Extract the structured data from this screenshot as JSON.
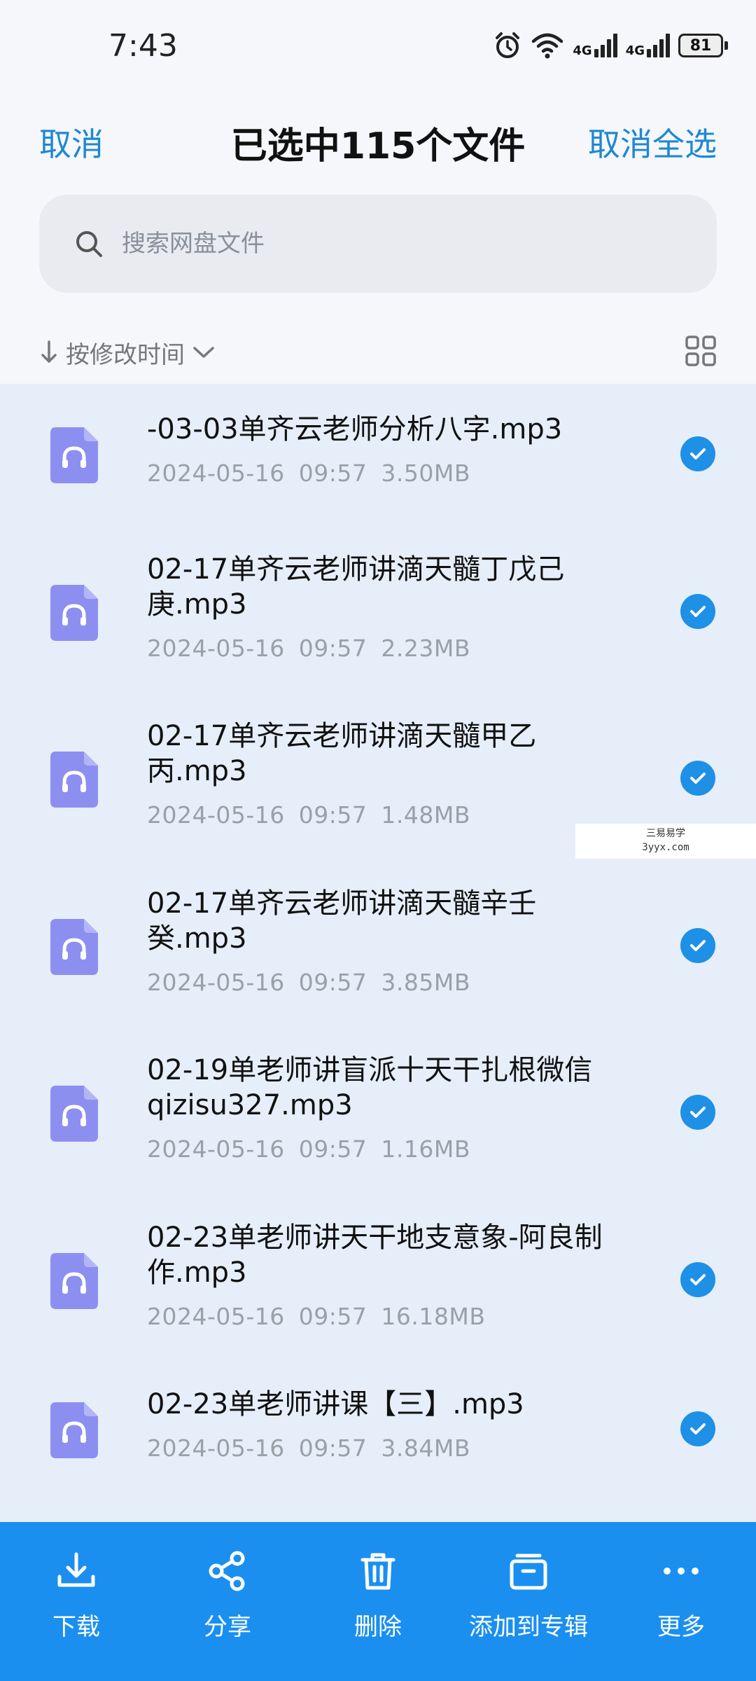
{
  "status_bar": {
    "time": "7:43",
    "network_1": "4G",
    "network_2": "4G",
    "battery": "81"
  },
  "header": {
    "cancel_label": "取消",
    "title": "已选中115个文件",
    "deselect_all_label": "取消全选"
  },
  "search": {
    "placeholder": "搜索网盘文件"
  },
  "sort": {
    "label": "按修改时间"
  },
  "files": [
    {
      "name_line1": "-03-03单齐云老师分析八字.mp3",
      "name_line2": "",
      "date": "2024-05-16",
      "time": "09:57",
      "size": "3.50MB",
      "selected": true
    },
    {
      "name_line1": "02-17单齐云老师讲滴天髓丁戊己",
      "name_line2": "庚.mp3",
      "date": "2024-05-16",
      "time": "09:57",
      "size": "2.23MB",
      "selected": true
    },
    {
      "name_line1": "02-17单齐云老师讲滴天髓甲乙",
      "name_line2": "丙.mp3",
      "date": "2024-05-16",
      "time": "09:57",
      "size": "1.48MB",
      "selected": true
    },
    {
      "name_line1": "02-17单齐云老师讲滴天髓辛壬",
      "name_line2": "癸.mp3",
      "date": "2024-05-16",
      "time": "09:57",
      "size": "3.85MB",
      "selected": true
    },
    {
      "name_line1": "02-19单老师讲盲派十天干扎根微信",
      "name_line2": "qizisu327.mp3",
      "date": "2024-05-16",
      "time": "09:57",
      "size": "1.16MB",
      "selected": true
    },
    {
      "name_line1": "02-23单老师讲天干地支意象-阿良制",
      "name_line2": "作.mp3",
      "date": "2024-05-16",
      "time": "09:57",
      "size": "16.18MB",
      "selected": true
    },
    {
      "name_line1": "02-23单老师讲课【三】.mp3",
      "name_line2": "",
      "date": "2024-05-16",
      "time": "09:57",
      "size": "3.84MB",
      "selected": true
    }
  ],
  "watermark": {
    "line1": "三易易学",
    "line2": "3yyx.com"
  },
  "bottom_actions": [
    {
      "label": "下载",
      "icon": "download-icon"
    },
    {
      "label": "分享",
      "icon": "share-icon"
    },
    {
      "label": "删除",
      "icon": "trash-icon"
    },
    {
      "label": "添加到专辑",
      "icon": "album-icon"
    },
    {
      "label": "更多",
      "icon": "more-icon"
    }
  ],
  "colors": {
    "accent": "#1e88d2",
    "bottom_bar": "#1a8ff0",
    "check": "#1e90e6",
    "file_icon": "#8d8ff0",
    "list_bg": "#e6eef9"
  }
}
